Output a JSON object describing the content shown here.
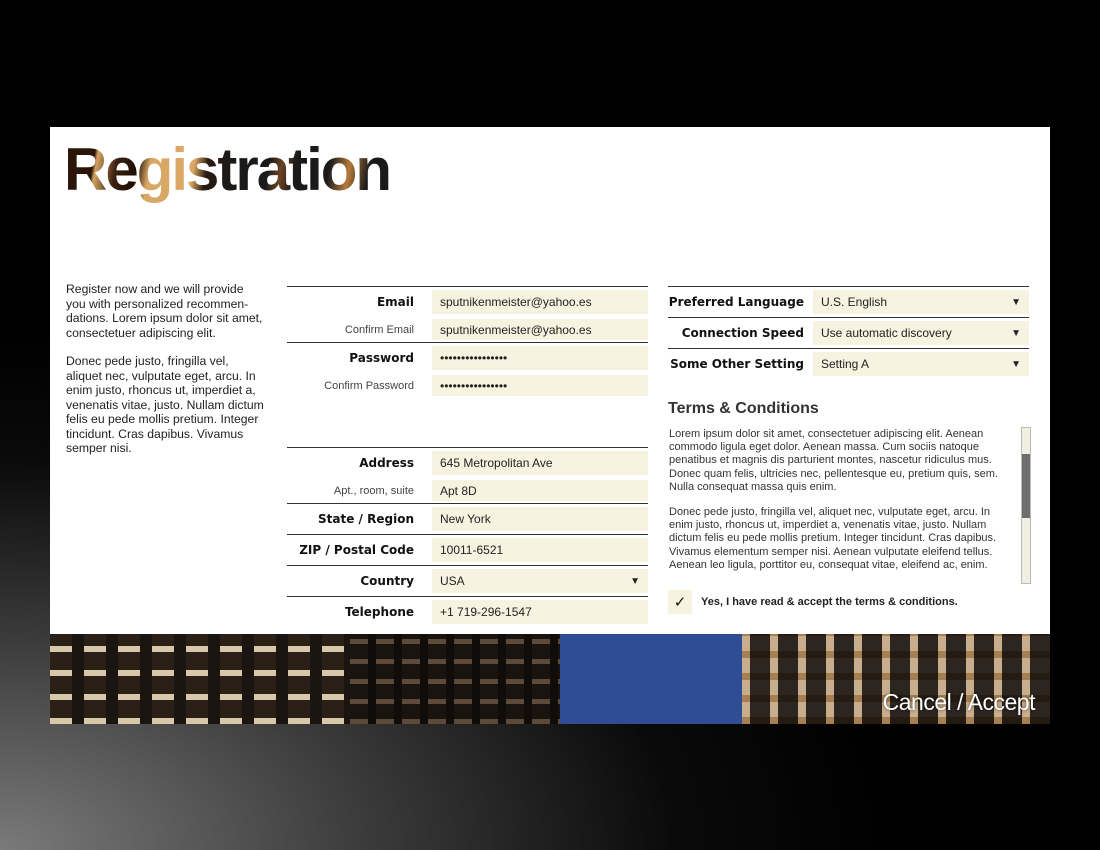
{
  "page": {
    "title": "Registration"
  },
  "intro": {
    "paragraph1": "Register now and we will provide you with personalized recommen-dations. Lorem ipsum dolor sit amet, consectetuer adipiscing elit.",
    "paragraph2": "Donec pede justo, fringilla vel, aliquet nec, vulputate eget, arcu. In enim justo, rhoncus ut, imperdiet a, venenatis vitae, justo. Nullam dictum felis eu pede mollis pretium. Integer tincidunt. Cras dapibus. Vivamus semper nisi."
  },
  "form": {
    "email": {
      "label": "Email",
      "value": "sputnikenmeister@yahoo.es"
    },
    "confirm_email": {
      "label": "Confirm Email",
      "value": "sputnikenmeister@yahoo.es"
    },
    "password": {
      "label": "Password",
      "value": "••••••••••••••••"
    },
    "confirm_password": {
      "label": "Confirm Password",
      "value": "••••••••••••••••"
    },
    "address": {
      "label": "Address",
      "value": "645 Metropolitan Ave"
    },
    "apt": {
      "label": "Apt., room, suite",
      "value": "Apt 8D"
    },
    "state": {
      "label": "State / Region",
      "value": "New York"
    },
    "zip": {
      "label": "ZIP / Postal Code",
      "value": "10011-6521"
    },
    "country": {
      "label": "Country",
      "value": "USA",
      "caret": "▼"
    },
    "telephone": {
      "label": "Telephone",
      "value": "+1 719-296-1547"
    }
  },
  "settings": {
    "language": {
      "label": "Preferred Language",
      "value": "U.S. English",
      "caret": "▼"
    },
    "speed": {
      "label": "Connection Speed",
      "value": "Use automatic discovery",
      "caret": "▼"
    },
    "other": {
      "label": "Some Other Setting",
      "value": "Setting A",
      "caret": "▼"
    }
  },
  "terms": {
    "heading": "Terms & Conditions",
    "paragraph1": "Lorem ipsum dolor sit amet, consectetuer adipiscing elit. Aenean commodo ligula eget dolor. Aenean massa. Cum sociis natoque penatibus et magnis dis parturient montes, nascetur ridiculus mus. Donec quam felis, ultricies nec, pellentesque eu, pretium quis, sem. Nulla consequat massa quis enim.",
    "paragraph2": "Donec pede justo, fringilla vel, aliquet nec, vulputate eget, arcu. In enim justo, rhoncus ut, imperdiet a, venenatis vitae, justo. Nullam dictum felis eu pede mollis pretium. Integer tincidunt. Cras dapibus. Vivamus elementum semper nisi. Aenean vulputate eleifend tellus. Aenean leo ligula, porttitor eu, consequat vitae, eleifend ac, enim.",
    "checkbox_mark": "✓",
    "accept_label": "Yes, I have read & accept the terms & conditions."
  },
  "actions": {
    "cancel": "Cancel",
    "separator": " / ",
    "accept": "Accept"
  }
}
